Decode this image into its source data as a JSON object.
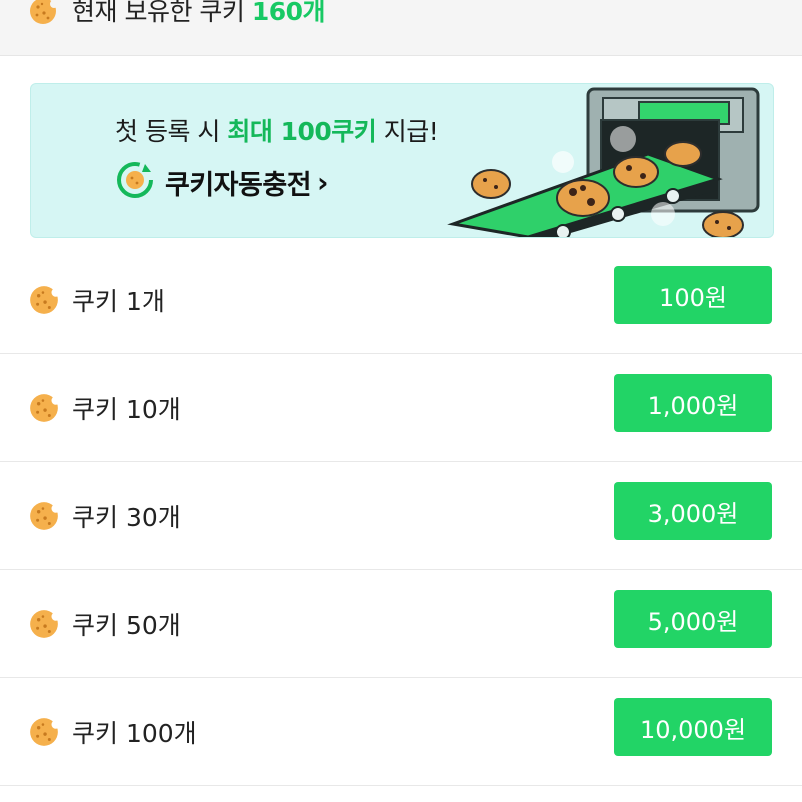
{
  "header": {
    "owned_prefix": "현재 보유한 쿠키",
    "owned_count": "160개"
  },
  "banner": {
    "line1_prefix": "첫 등록 시",
    "line1_highlight": "최대 100쿠키",
    "line1_suffix": "지급!",
    "cta_label": "쿠키자동충전",
    "cta_chevron": "›"
  },
  "products": [
    {
      "label": "쿠키 1개",
      "price": "100원"
    },
    {
      "label": "쿠키 10개",
      "price": "1,000원"
    },
    {
      "label": "쿠키 30개",
      "price": "3,000원"
    },
    {
      "label": "쿠키 50개",
      "price": "5,000원"
    },
    {
      "label": "쿠키 100개",
      "price": "10,000원"
    }
  ],
  "colors": {
    "accent_green": "#22d466",
    "highlight_green": "#14b85a",
    "banner_bg": "#d6f6f4",
    "cookie": "#f5b04c"
  },
  "icons": [
    "cookie-icon",
    "auto-charge-icon",
    "chevron-right-icon"
  ]
}
